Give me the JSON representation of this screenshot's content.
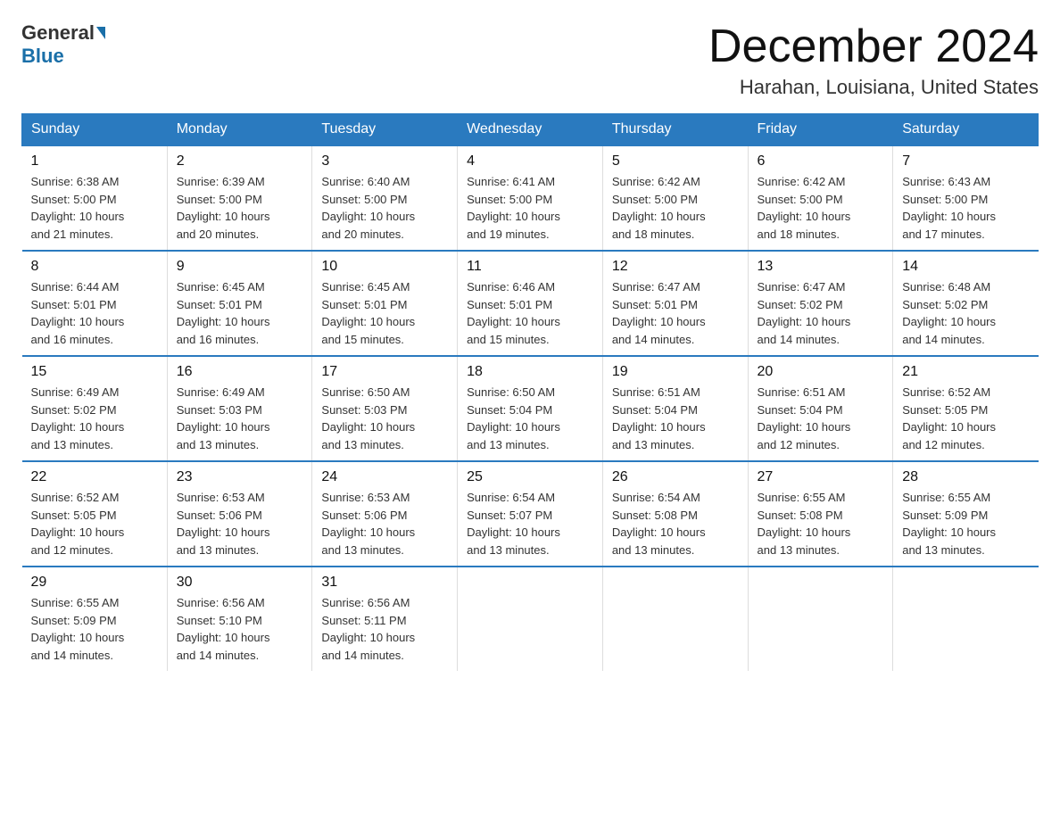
{
  "logo": {
    "general": "General",
    "blue": "Blue"
  },
  "header": {
    "month": "December 2024",
    "location": "Harahan, Louisiana, United States"
  },
  "days_of_week": [
    "Sunday",
    "Monday",
    "Tuesday",
    "Wednesday",
    "Thursday",
    "Friday",
    "Saturday"
  ],
  "weeks": [
    [
      {
        "day": "1",
        "info": "Sunrise: 6:38 AM\nSunset: 5:00 PM\nDaylight: 10 hours\nand 21 minutes."
      },
      {
        "day": "2",
        "info": "Sunrise: 6:39 AM\nSunset: 5:00 PM\nDaylight: 10 hours\nand 20 minutes."
      },
      {
        "day": "3",
        "info": "Sunrise: 6:40 AM\nSunset: 5:00 PM\nDaylight: 10 hours\nand 20 minutes."
      },
      {
        "day": "4",
        "info": "Sunrise: 6:41 AM\nSunset: 5:00 PM\nDaylight: 10 hours\nand 19 minutes."
      },
      {
        "day": "5",
        "info": "Sunrise: 6:42 AM\nSunset: 5:00 PM\nDaylight: 10 hours\nand 18 minutes."
      },
      {
        "day": "6",
        "info": "Sunrise: 6:42 AM\nSunset: 5:00 PM\nDaylight: 10 hours\nand 18 minutes."
      },
      {
        "day": "7",
        "info": "Sunrise: 6:43 AM\nSunset: 5:00 PM\nDaylight: 10 hours\nand 17 minutes."
      }
    ],
    [
      {
        "day": "8",
        "info": "Sunrise: 6:44 AM\nSunset: 5:01 PM\nDaylight: 10 hours\nand 16 minutes."
      },
      {
        "day": "9",
        "info": "Sunrise: 6:45 AM\nSunset: 5:01 PM\nDaylight: 10 hours\nand 16 minutes."
      },
      {
        "day": "10",
        "info": "Sunrise: 6:45 AM\nSunset: 5:01 PM\nDaylight: 10 hours\nand 15 minutes."
      },
      {
        "day": "11",
        "info": "Sunrise: 6:46 AM\nSunset: 5:01 PM\nDaylight: 10 hours\nand 15 minutes."
      },
      {
        "day": "12",
        "info": "Sunrise: 6:47 AM\nSunset: 5:01 PM\nDaylight: 10 hours\nand 14 minutes."
      },
      {
        "day": "13",
        "info": "Sunrise: 6:47 AM\nSunset: 5:02 PM\nDaylight: 10 hours\nand 14 minutes."
      },
      {
        "day": "14",
        "info": "Sunrise: 6:48 AM\nSunset: 5:02 PM\nDaylight: 10 hours\nand 14 minutes."
      }
    ],
    [
      {
        "day": "15",
        "info": "Sunrise: 6:49 AM\nSunset: 5:02 PM\nDaylight: 10 hours\nand 13 minutes."
      },
      {
        "day": "16",
        "info": "Sunrise: 6:49 AM\nSunset: 5:03 PM\nDaylight: 10 hours\nand 13 minutes."
      },
      {
        "day": "17",
        "info": "Sunrise: 6:50 AM\nSunset: 5:03 PM\nDaylight: 10 hours\nand 13 minutes."
      },
      {
        "day": "18",
        "info": "Sunrise: 6:50 AM\nSunset: 5:04 PM\nDaylight: 10 hours\nand 13 minutes."
      },
      {
        "day": "19",
        "info": "Sunrise: 6:51 AM\nSunset: 5:04 PM\nDaylight: 10 hours\nand 13 minutes."
      },
      {
        "day": "20",
        "info": "Sunrise: 6:51 AM\nSunset: 5:04 PM\nDaylight: 10 hours\nand 12 minutes."
      },
      {
        "day": "21",
        "info": "Sunrise: 6:52 AM\nSunset: 5:05 PM\nDaylight: 10 hours\nand 12 minutes."
      }
    ],
    [
      {
        "day": "22",
        "info": "Sunrise: 6:52 AM\nSunset: 5:05 PM\nDaylight: 10 hours\nand 12 minutes."
      },
      {
        "day": "23",
        "info": "Sunrise: 6:53 AM\nSunset: 5:06 PM\nDaylight: 10 hours\nand 13 minutes."
      },
      {
        "day": "24",
        "info": "Sunrise: 6:53 AM\nSunset: 5:06 PM\nDaylight: 10 hours\nand 13 minutes."
      },
      {
        "day": "25",
        "info": "Sunrise: 6:54 AM\nSunset: 5:07 PM\nDaylight: 10 hours\nand 13 minutes."
      },
      {
        "day": "26",
        "info": "Sunrise: 6:54 AM\nSunset: 5:08 PM\nDaylight: 10 hours\nand 13 minutes."
      },
      {
        "day": "27",
        "info": "Sunrise: 6:55 AM\nSunset: 5:08 PM\nDaylight: 10 hours\nand 13 minutes."
      },
      {
        "day": "28",
        "info": "Sunrise: 6:55 AM\nSunset: 5:09 PM\nDaylight: 10 hours\nand 13 minutes."
      }
    ],
    [
      {
        "day": "29",
        "info": "Sunrise: 6:55 AM\nSunset: 5:09 PM\nDaylight: 10 hours\nand 14 minutes."
      },
      {
        "day": "30",
        "info": "Sunrise: 6:56 AM\nSunset: 5:10 PM\nDaylight: 10 hours\nand 14 minutes."
      },
      {
        "day": "31",
        "info": "Sunrise: 6:56 AM\nSunset: 5:11 PM\nDaylight: 10 hours\nand 14 minutes."
      },
      {
        "day": "",
        "info": ""
      },
      {
        "day": "",
        "info": ""
      },
      {
        "day": "",
        "info": ""
      },
      {
        "day": "",
        "info": ""
      }
    ]
  ]
}
